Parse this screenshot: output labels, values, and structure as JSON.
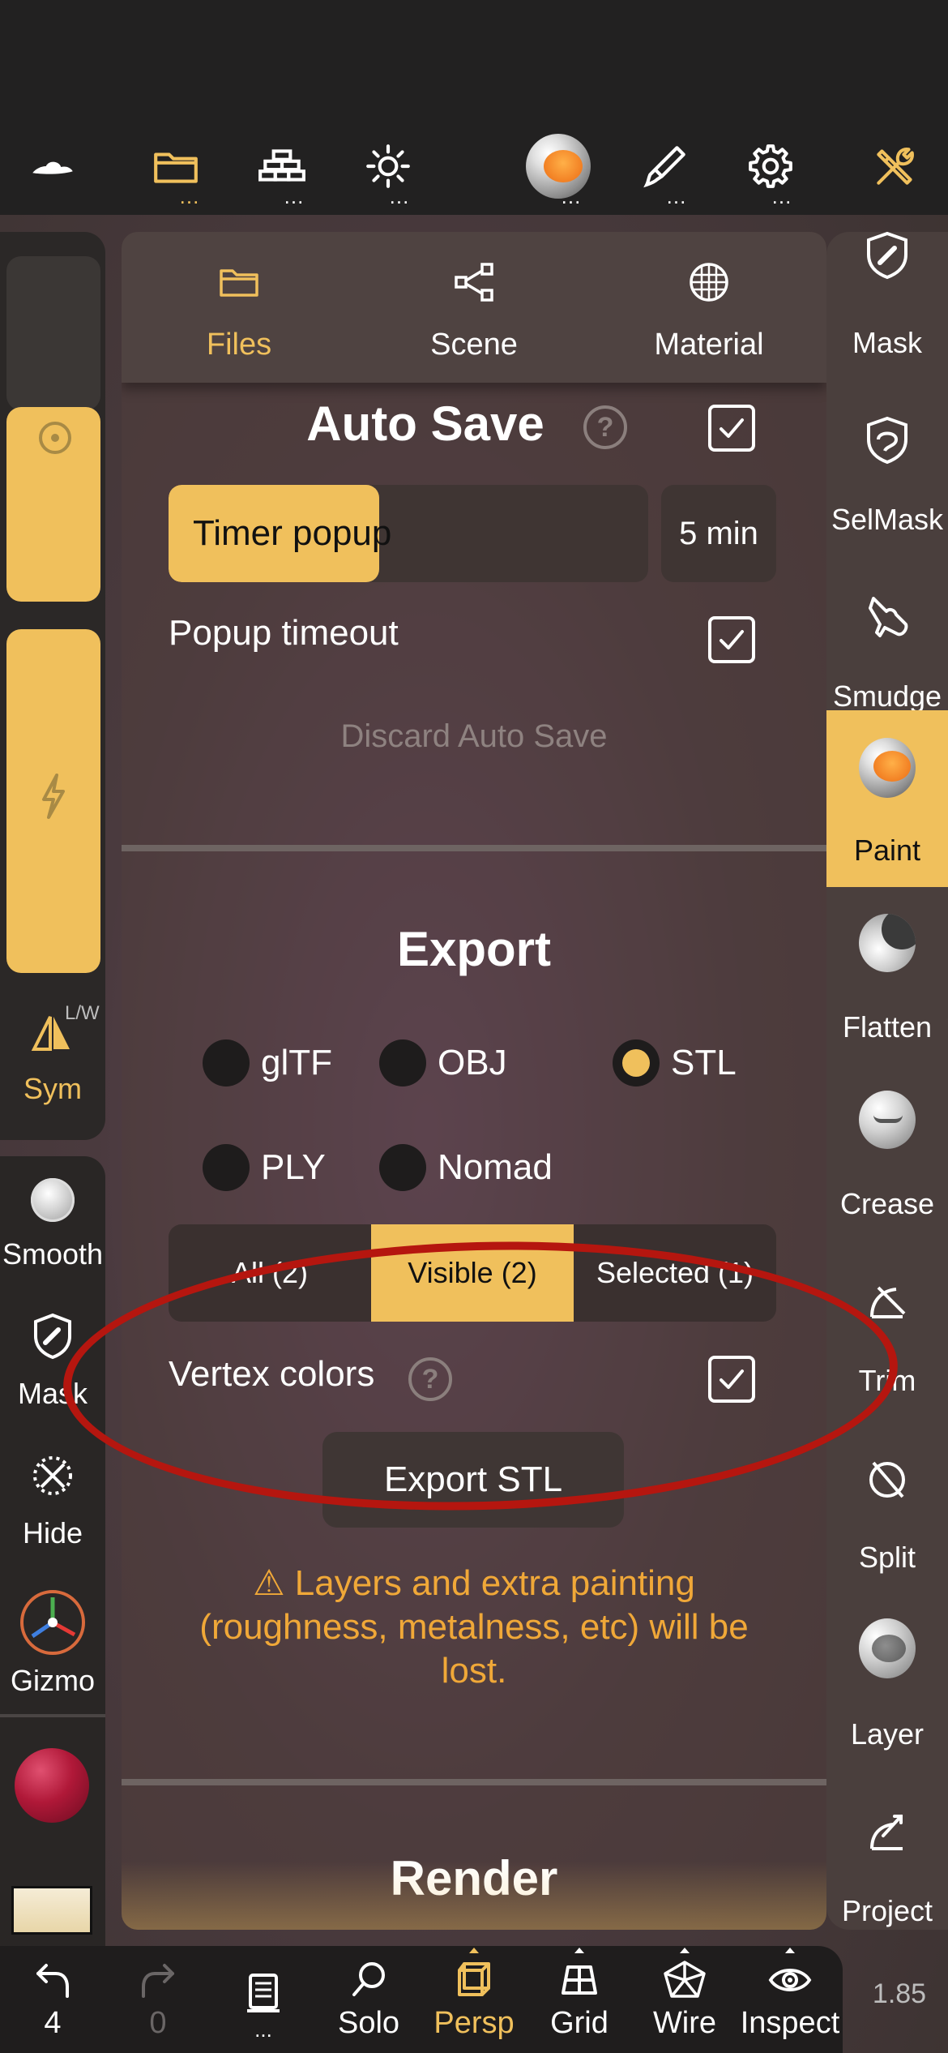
{
  "top_toolbar": {
    "items": [
      {
        "icon": "hat-icon"
      },
      {
        "icon": "folder-icon",
        "active": true
      },
      {
        "icon": "scene-layers-icon"
      },
      {
        "icon": "sun-icon"
      },
      {
        "icon": "material-ball-icon"
      },
      {
        "icon": "brush-icon"
      },
      {
        "icon": "gear-icon"
      },
      {
        "icon": "tools-icon"
      }
    ],
    "more_indicator": "..."
  },
  "panel": {
    "tabs": [
      {
        "label": "Files",
        "icon": "folder-icon",
        "active": true
      },
      {
        "label": "Scene",
        "icon": "share-nodes-icon"
      },
      {
        "label": "Material",
        "icon": "grid-sphere-icon"
      }
    ],
    "auto_save": {
      "title": "Auto Save",
      "help": "?",
      "checked": true,
      "timer_label": "Timer popup",
      "timer_value": "5 min",
      "timer_fill": 0.44,
      "popup_timeout_label": "Popup timeout",
      "popup_timeout_checked": true,
      "discard_label": "Discard Auto Save"
    },
    "export": {
      "title": "Export",
      "formats": [
        {
          "label": "glTF",
          "selected": false
        },
        {
          "label": "OBJ",
          "selected": false
        },
        {
          "label": "STL",
          "selected": true
        },
        {
          "label": "PLY",
          "selected": false
        },
        {
          "label": "Nomad",
          "selected": false
        }
      ],
      "scope": [
        {
          "label": "All (2)",
          "active": false
        },
        {
          "label": "Visible (2)",
          "active": true
        },
        {
          "label": "Selected (1)",
          "active": false
        }
      ],
      "vertex_colors_label": "Vertex colors",
      "vertex_colors_help": "?",
      "vertex_colors_checked": true,
      "export_button": "Export STL",
      "warning": "⚠ Layers and extra painting (roughness, metalness, etc) will be lost."
    },
    "render_title": "Render"
  },
  "left_rail": {
    "sym_label": "Sym",
    "sym_badge": "L/W",
    "tools": [
      {
        "label": "Smooth",
        "icon": "smooth-icon"
      },
      {
        "label": "Mask",
        "icon": "mask-shield-icon"
      },
      {
        "label": "Hide",
        "icon": "hide-icon"
      },
      {
        "label": "Gizmo",
        "icon": "gizmo-icon"
      }
    ]
  },
  "right_rail": {
    "tools": [
      {
        "label": "Mask",
        "icon": "mask-icon"
      },
      {
        "label": "SelMask",
        "icon": "selmask-icon"
      },
      {
        "label": "Smudge",
        "icon": "smudge-icon"
      },
      {
        "label": "Paint",
        "icon": "paint-ball-icon",
        "active": true
      },
      {
        "label": "Flatten",
        "icon": "flatten-icon"
      },
      {
        "label": "Crease",
        "icon": "crease-icon"
      },
      {
        "label": "Trim",
        "icon": "trim-icon"
      },
      {
        "label": "Split",
        "icon": "split-icon"
      },
      {
        "label": "Layer",
        "icon": "layer-icon"
      },
      {
        "label": "Project",
        "icon": "project-icon"
      }
    ]
  },
  "bottom_toolbar": {
    "items": [
      {
        "label": "4",
        "icon": "undo-icon"
      },
      {
        "label": "0",
        "icon": "redo-icon",
        "dim": true
      },
      {
        "label": "...",
        "icon": "notes-icon"
      },
      {
        "label": "Solo",
        "icon": "search-icon"
      },
      {
        "label": "Persp",
        "icon": "cube-icon",
        "active": true
      },
      {
        "label": "Grid",
        "icon": "grid-icon"
      },
      {
        "label": "Wire",
        "icon": "wireframe-icon"
      },
      {
        "label": "Inspect",
        "icon": "eye-icon"
      }
    ],
    "zoom": "1.85"
  },
  "colors": {
    "accent": "#f0c05c",
    "warning": "#f0a838",
    "annotation": "#b5160f"
  }
}
